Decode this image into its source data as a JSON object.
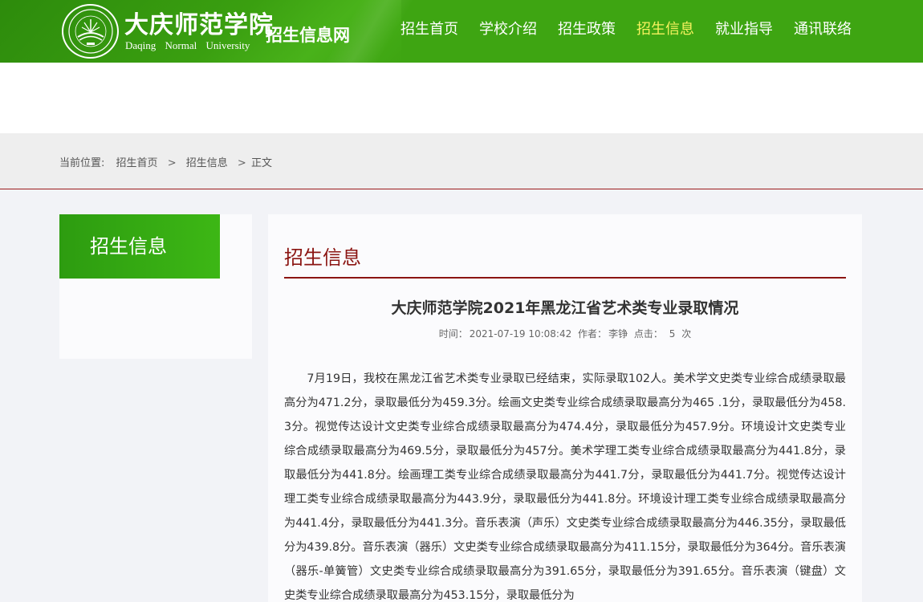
{
  "header": {
    "school_name_cn": "大庆师范学院",
    "school_name_en": "Daqing Normal University",
    "site_name": "招生信息网"
  },
  "nav": {
    "items": [
      {
        "label": "招生首页"
      },
      {
        "label": "学校介绍"
      },
      {
        "label": "招生政策"
      },
      {
        "label": "招生信息",
        "active": true
      },
      {
        "label": "就业指导"
      },
      {
        "label": "通讯联络"
      }
    ],
    "active_color": "#f6f25e"
  },
  "breadcrumb": {
    "prefix": "当前位置:",
    "home": "招生首页",
    "sep1": ">",
    "section": "招生信息",
    "sep2": ">",
    "current": "正文"
  },
  "sidebar": {
    "title": "招生信息"
  },
  "main": {
    "section_title": "招生信息",
    "article": {
      "title": "大庆师范学院2021年黑龙江省艺术类专业录取情况",
      "time_label": "时间：",
      "time": "2021-07-19 10:08:42",
      "author_label": "作者：",
      "author": "李铮",
      "clicks_label": "点击：",
      "clicks": "5",
      "clicks_unit": "次",
      "body": "7月19日，我校在黑龙江省艺术类专业录取已经结束，实际录取102人。美术学文史类专业综合成绩录取最高分为471.2分，录取最低分为459.3分。绘画文史类专业综合成绩录取最高分为465 .1分，录取最低分为458.3分。视觉传达设计文史类专业综合成绩录取最高分为474.4分，录取最低分为457.9分。环境设计文史类专业综合成绩录取最高分为469.5分，录取最低分为457分。美术学理工类专业综合成绩录取最高分为441.8分，录取最低分为441.8分。绘画理工类专业综合成绩录取最高分为441.7分，录取最低分为441.7分。视觉传达设计理工类专业综合成绩录取最高分为443.9分，录取最低分为441.8分。环境设计理工类专业综合成绩录取最高分为441.4分，录取最低分为441.3分。音乐表演（声乐）文史类专业综合成绩录取最高分为446.35分，录取最低分为439.8分。音乐表演（器乐）文史类专业综合成绩录取最高分为411.15分，录取最低分为364分。音乐表演（器乐-单簧管）文史类专业综合成绩录取最高分为391.65分，录取最低分为391.65分。音乐表演（键盘）文史类专业综合成绩录取最高分为453.15分，录取最低分为"
    }
  },
  "colors": {
    "header_green": "#3ea512",
    "accent_red": "#8b1512",
    "sidebar_green": "#34a512"
  }
}
